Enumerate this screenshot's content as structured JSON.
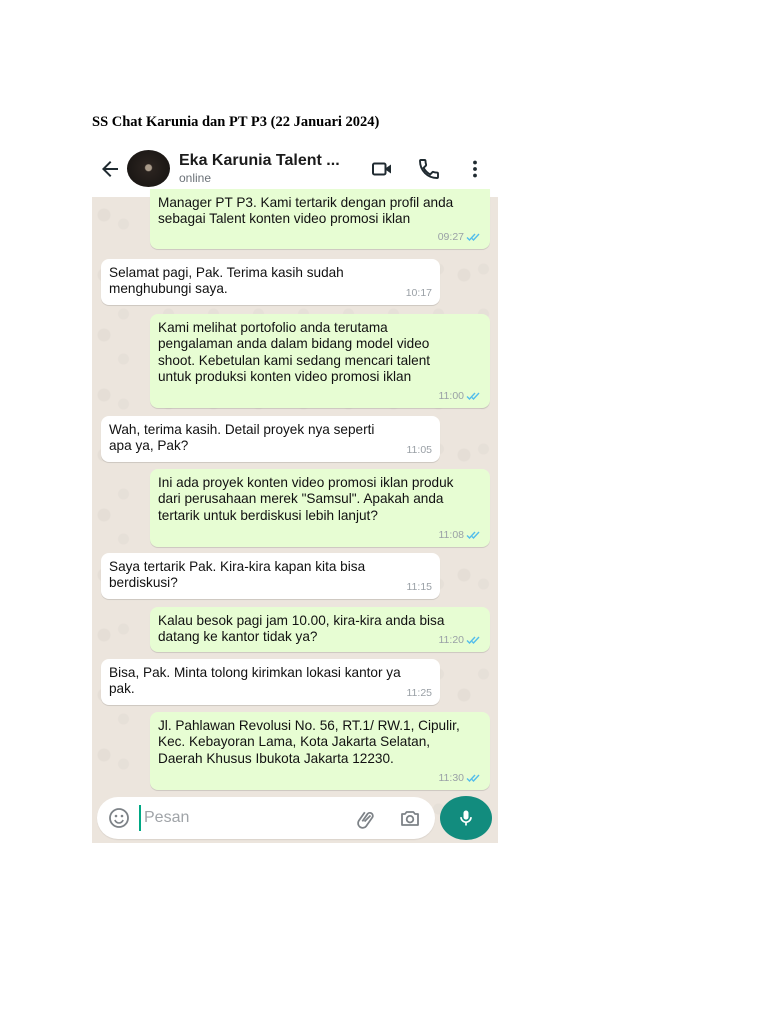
{
  "caption": "SS Chat Karunia dan PT P3 (22 Januari 2024)",
  "header": {
    "contact_name": "Eka Karunia Talent ...",
    "status": "online"
  },
  "messages": [
    {
      "direction": "out",
      "text": "Manager PT P3. Kami tertarik dengan profil anda sebagai Talent konten video promosi iklan",
      "time": "09:27",
      "read": true
    },
    {
      "direction": "in",
      "text": "Selamat pagi, Pak. Terima kasih sudah menghubungi saya.",
      "time": "10:17"
    },
    {
      "direction": "out",
      "text": "Kami melihat portofolio anda terutama pengalaman anda dalam bidang model video shoot. Kebetulan kami sedang mencari talent untuk produksi konten video promosi iklan",
      "time": "11:00",
      "read": true
    },
    {
      "direction": "in",
      "text": "Wah, terima kasih. Detail proyek nya seperti apa ya, Pak?",
      "time": "11:05"
    },
    {
      "direction": "out",
      "text": "Ini ada proyek konten video promosi iklan produk dari perusahaan merek \"Samsul\". Apakah anda tertarik untuk berdiskusi lebih lanjut?",
      "time": "11:08",
      "read": true
    },
    {
      "direction": "in",
      "text": "Saya tertarik Pak. Kira-kira kapan kita bisa berdiskusi?",
      "time": "11:15"
    },
    {
      "direction": "out",
      "text": "Kalau besok pagi jam 10.00, kira-kira anda bisa datang ke kantor tidak ya?",
      "time": "11:20",
      "read": true
    },
    {
      "direction": "in",
      "text": "Bisa, Pak. Minta tolong kirimkan lokasi kantor ya pak.",
      "time": "11:25"
    },
    {
      "direction": "out",
      "text": "Jl. Pahlawan Revolusi No. 56, RT.1/ RW.1, Cipulir, Kec. Kebayoran Lama, Kota Jakarta Selatan, Daerah Khusus Ibukota Jakarta 12230.",
      "time": "11:30",
      "read": true
    }
  ],
  "input": {
    "placeholder": "Pesan"
  },
  "icons": {
    "back": "back-arrow-icon",
    "video": "video-camera-icon",
    "call": "phone-icon",
    "menu": "more-vertical-icon",
    "emoji": "emoji-icon",
    "attach": "paperclip-icon",
    "camera": "camera-icon",
    "mic": "microphone-icon"
  },
  "colors": {
    "chat_bg": "#ece5dd",
    "outgoing_bubble": "#e7fdd3",
    "incoming_bubble": "#ffffff",
    "read_ticks": "#53bdeb",
    "mic_button": "#128c7e"
  }
}
